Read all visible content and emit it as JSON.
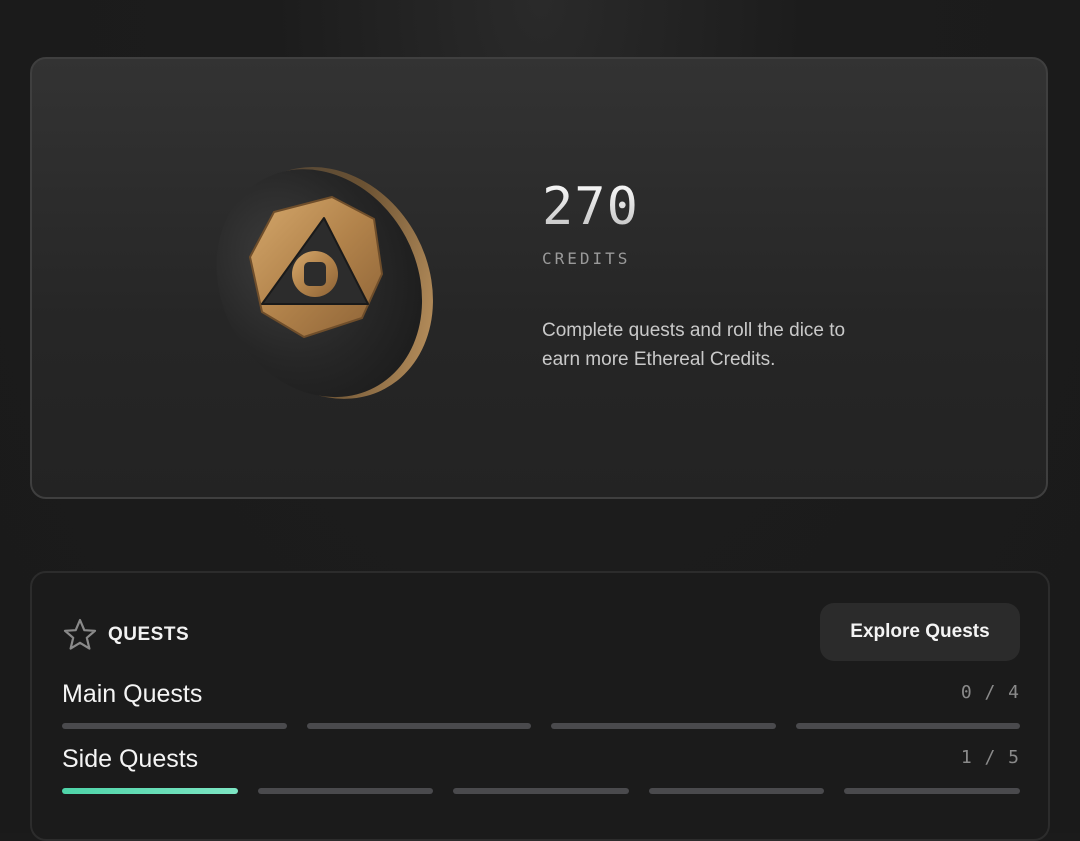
{
  "credits": {
    "amount": "270",
    "label": "CREDITS",
    "description": "Complete quests and roll the dice to earn more Ethereal Credits."
  },
  "quests": {
    "title": "QUESTS",
    "explore_label": "Explore Quests",
    "main": {
      "label": "Main Quests",
      "count": "0 / 4",
      "completed": 0,
      "total": 4
    },
    "side": {
      "label": "Side Quests",
      "count": "1 / 5",
      "completed": 1,
      "total": 5
    }
  },
  "colors": {
    "accent": "#5ddcb2",
    "coin_gold": "#b88a4e",
    "coin_body": "#2e2e2e"
  },
  "icons": {
    "coin": "credits-coin-icon",
    "quests": "star-icon"
  }
}
